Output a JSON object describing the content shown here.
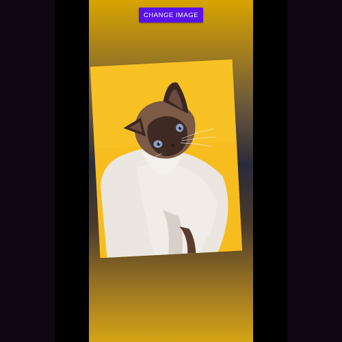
{
  "toolbar": {
    "change_image_label": "CHANGE IMAGE"
  },
  "image": {
    "subject": "siamese-cat-photo",
    "background_color": "#f7bd1f"
  },
  "colors": {
    "button": "#5a12e8",
    "screen_top": "#d7a400",
    "screen_middle": "#2b2b3a",
    "screen_bottom": "#d5a415"
  }
}
